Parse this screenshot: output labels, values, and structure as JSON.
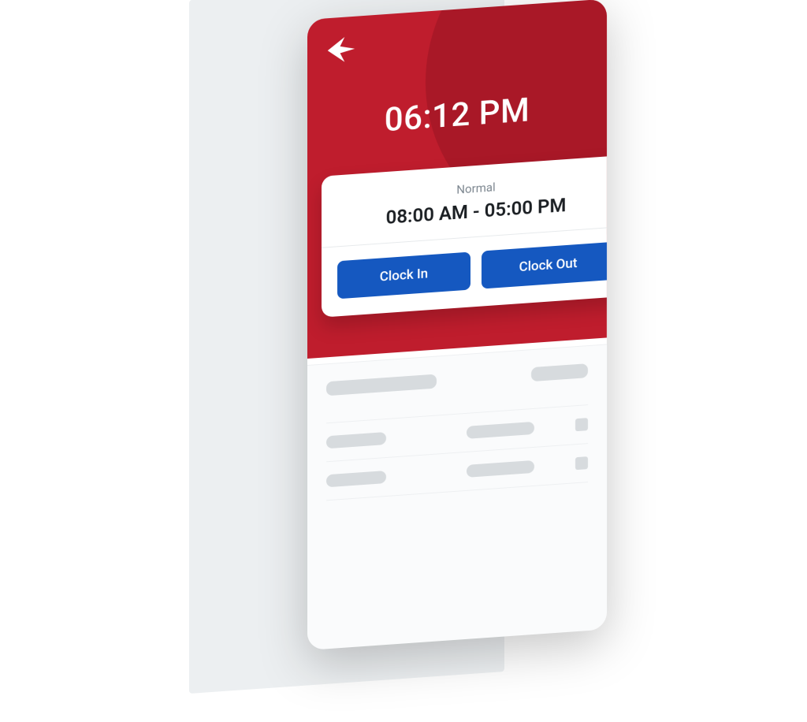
{
  "colors": {
    "brand_red": "#bf1d2d",
    "brand_blue": "#1558c0"
  },
  "header": {
    "logo": "arrow-logo",
    "current_time": "06:12 PM"
  },
  "shift_card": {
    "label": "Normal",
    "range": "08:00 AM - 05:00 PM",
    "clock_in_label": "Clock In",
    "clock_out_label": "Clock Out"
  }
}
